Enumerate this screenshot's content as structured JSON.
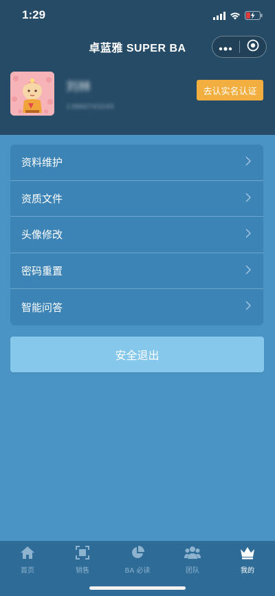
{
  "status_bar": {
    "time": "1:29"
  },
  "header": {
    "title": "卓蓝雅 SUPER BA"
  },
  "profile": {
    "name": "刘林",
    "phone": "13860743245",
    "verify_label": "去认实名认证"
  },
  "menu": {
    "items": [
      {
        "label": "资料维护"
      },
      {
        "label": "资质文件"
      },
      {
        "label": "头像修改"
      },
      {
        "label": "密码重置"
      },
      {
        "label": "智能问答"
      }
    ]
  },
  "logout_label": "安全退出",
  "tabbar": {
    "tabs": [
      {
        "label": "首页",
        "icon": "home-icon"
      },
      {
        "label": "销售",
        "icon": "scan-icon"
      },
      {
        "label": "BA 必读",
        "icon": "pie-chart-icon"
      },
      {
        "label": "团队",
        "icon": "team-icon"
      },
      {
        "label": "我的",
        "icon": "crown-icon",
        "active": true
      }
    ]
  },
  "colors": {
    "header_bg": "#264b66",
    "page_bg": "#4a93c5",
    "menu_bg": "#3d84b6",
    "verify_btn": "#f2ae3e",
    "logout_btn": "#85c8ec",
    "tabbar_bg": "#2e6b96"
  }
}
